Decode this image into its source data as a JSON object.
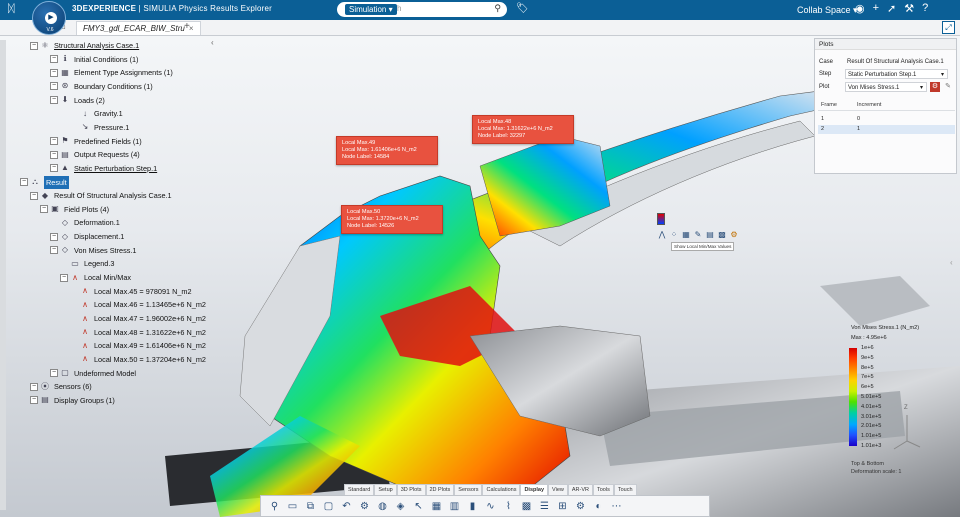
{
  "header": {
    "brand_prefix": "3DEXPERIENCE",
    "brand_suffix": " | SIMULIA",
    "app_name": "Physics Results Explorer",
    "compass_version": "V.6",
    "search_scope": "Simulation",
    "search_placeholder": "h",
    "search_icon": "search-icon",
    "collab_space": "Collab Space",
    "tab_title": "FMY3_gdl_ECAR_BIW_Stru",
    "tab_add": "+",
    "colors": {
      "header_bg": "#0b5f96",
      "highlight": "#1f6fb6"
    }
  },
  "tree": {
    "items": [
      {
        "label": "Structural Analysis Case.1",
        "style": "ul"
      },
      {
        "label": "Initial Conditions (1)"
      },
      {
        "label": "Element Type Assignments (1)"
      },
      {
        "label": "Boundary Conditions (1)"
      },
      {
        "label": "Loads (2)"
      },
      {
        "label": "Gravity.1"
      },
      {
        "label": "Pressure.1"
      },
      {
        "label": "Predefined Fields (1)"
      },
      {
        "label": "Output Requests (4)"
      },
      {
        "label": "Static Perturbation Step.1",
        "style": "ul"
      },
      {
        "label": "Result",
        "style": "hl"
      },
      {
        "label": "Result Of Structural Analysis Case.1"
      },
      {
        "label": "Field Plots (4)"
      },
      {
        "label": "Deformation.1"
      },
      {
        "label": "Displacement.1"
      },
      {
        "label": "Von Mises Stress.1"
      },
      {
        "label": "Legend.3"
      },
      {
        "label": "Local Min/Max"
      },
      {
        "label": "Local Max.45 = 978091 N_m2"
      },
      {
        "label": "Local Max.46 = 1.13465e+6 N_m2"
      },
      {
        "label": "Local Max.47 = 1.96002e+6 N_m2"
      },
      {
        "label": "Local Max.48 = 1.31622e+6 N_m2"
      },
      {
        "label": "Local Max.49 = 1.61406e+6 N_m2"
      },
      {
        "label": "Local Max.50 = 1.37204e+6 N_m2"
      },
      {
        "label": "Undeformed Model"
      },
      {
        "label": "Sensors (6)"
      },
      {
        "label": "Display Groups (1)"
      }
    ]
  },
  "annotations": [
    {
      "line1": "Local Max.49",
      "line2": "Local Max: 1.61406e+6 N_m2",
      "line3": "Node Label: 14584"
    },
    {
      "line1": "Local Max.48",
      "line2": "Local Max: 1.31622e+6 N_m2",
      "line3": "Node Label: 32297"
    },
    {
      "line1": "Local Max.50",
      "line2": "Local Max: 1.3720e+6 N_m2",
      "line3": "Node Label: 14526"
    }
  ],
  "plots_panel": {
    "title": "Plots",
    "case_label": "Case",
    "case_value": "Result Of Structural Analysis Case.1",
    "step_label": "Step",
    "step_value": "Static Perturbation Step.1",
    "plot_label": "Plot",
    "plot_value": "Von Mises Stress.1",
    "col_frame": "Frame",
    "col_increment": "Increment",
    "rows": [
      {
        "frame": "1",
        "increment": "0"
      },
      {
        "frame": "2",
        "increment": "1"
      }
    ]
  },
  "legend": {
    "title": "Von Mises Stress.1 (N_m2)",
    "max": "Max : 4.95e+6",
    "ticks": [
      "1e+6",
      "9e+5",
      "8e+5",
      "7e+5",
      "6e+5",
      "5.01e+5",
      "4.01e+5",
      "3.01e+5",
      "2.01e+5",
      "1.01e+5",
      "1.01e+3"
    ],
    "footer1": "Top & Bottom",
    "footer2": "Deformation scale: 1"
  },
  "floating_toolbar": {
    "tooltip": "Show Local Min/Max Values"
  },
  "action_tabs": [
    {
      "label": "Standard"
    },
    {
      "label": "Setup"
    },
    {
      "label": "3D Plots"
    },
    {
      "label": "2D Plots"
    },
    {
      "label": "Sensors"
    },
    {
      "label": "Calculations"
    },
    {
      "label": "Display",
      "active": true
    },
    {
      "label": "View"
    },
    {
      "label": "AR-VR"
    },
    {
      "label": "Tools"
    },
    {
      "label": "Touch"
    }
  ],
  "compass_axis": "Z"
}
